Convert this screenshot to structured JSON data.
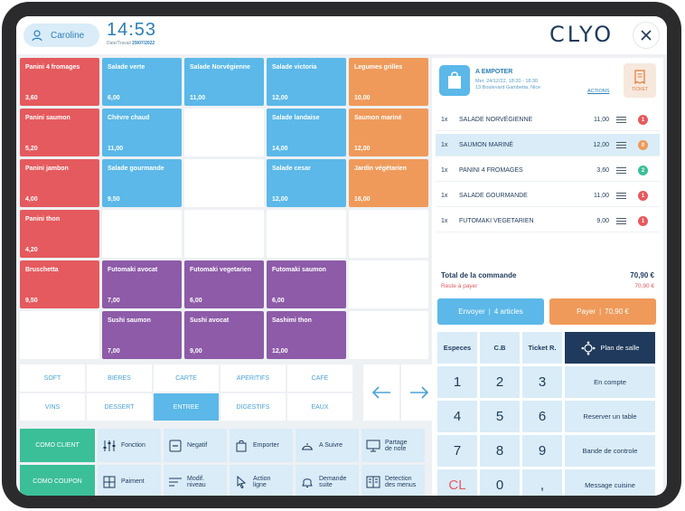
{
  "header": {
    "user_name": "Caroline",
    "clock": "14:53",
    "date_label": "Date/Travail",
    "date_value": "29/07/2022",
    "logo": "CLYO",
    "close_icon": "close-icon"
  },
  "products": [
    {
      "name": "Panini 4 fromages",
      "price": "3,60",
      "color": "red"
    },
    {
      "name": "Salade verte",
      "price": "6,00",
      "color": "blue"
    },
    {
      "name": "Salade Norvégienne",
      "price": "11,00",
      "color": "blue"
    },
    {
      "name": "Salade victoria",
      "price": "12,00",
      "color": "blue"
    },
    {
      "name": "Legumes grilles",
      "price": "10,00",
      "color": "orange"
    },
    {
      "name": "Panini saumon",
      "price": "5,20",
      "color": "red"
    },
    {
      "name": "Chèvre chaud",
      "price": "11,00",
      "color": "blue"
    },
    {
      "name": "",
      "price": "",
      "color": "empty"
    },
    {
      "name": "Salade landaise",
      "price": "14,00",
      "color": "blue"
    },
    {
      "name": "Saumon mariné",
      "price": "12,00",
      "color": "orange"
    },
    {
      "name": "Panini jambon",
      "price": "4,00",
      "color": "red"
    },
    {
      "name": "Salade gourmande",
      "price": "9,50",
      "color": "blue"
    },
    {
      "name": "",
      "price": "",
      "color": "empty"
    },
    {
      "name": "Salade cesar",
      "price": "12,00",
      "color": "blue"
    },
    {
      "name": "Jardin végétarien",
      "price": "16,00",
      "color": "orange"
    },
    {
      "name": "Panini thon",
      "price": "4,20",
      "color": "red"
    },
    {
      "name": "",
      "price": "",
      "color": "empty"
    },
    {
      "name": "",
      "price": "",
      "color": "empty"
    },
    {
      "name": "",
      "price": "",
      "color": "empty"
    },
    {
      "name": "",
      "price": "",
      "color": "empty"
    },
    {
      "name": "Bruschetta",
      "price": "9,50",
      "color": "red"
    },
    {
      "name": "Futomaki avocat",
      "price": "7,00",
      "color": "purple"
    },
    {
      "name": "Futomaki vegetarien",
      "price": "6,00",
      "color": "purple"
    },
    {
      "name": "Futomaki saumon",
      "price": "6,00",
      "color": "purple"
    },
    {
      "name": "",
      "price": "",
      "color": "empty"
    },
    {
      "name": "",
      "price": "",
      "color": "empty"
    },
    {
      "name": "Sushi saumon",
      "price": "7,00",
      "color": "purple"
    },
    {
      "name": "Sushi avocat",
      "price": "9,00",
      "color": "purple"
    },
    {
      "name": "Sashimi thon",
      "price": "12,00",
      "color": "purple"
    },
    {
      "name": "",
      "price": "",
      "color": "empty"
    }
  ],
  "categories": [
    {
      "label": "SOFT",
      "active": false
    },
    {
      "label": "BIERES",
      "active": false
    },
    {
      "label": "CARTE",
      "active": false
    },
    {
      "label": "APERITIFS",
      "active": false
    },
    {
      "label": "CAFE",
      "active": false
    },
    {
      "label": "VINS",
      "active": false
    },
    {
      "label": "DESSERT",
      "active": false
    },
    {
      "label": "ENTREE",
      "active": true
    },
    {
      "label": "DIGESTIFS",
      "active": false
    },
    {
      "label": "EAUX",
      "active": false
    }
  ],
  "functions": {
    "como_client": "COMO CLIENT",
    "como_coupon": "COMO COUPON",
    "row1": [
      {
        "label": "Fonction",
        "icon": "sliders-icon"
      },
      {
        "label": "Negatif",
        "icon": "minus-box-icon"
      },
      {
        "label": "Emporter",
        "icon": "bag-icon"
      },
      {
        "label": "A Suivre",
        "icon": "cloche-icon"
      },
      {
        "label": "Partage de note",
        "icon": "split-icon"
      }
    ],
    "row2": [
      {
        "label": "Paiment",
        "icon": "calculator-icon"
      },
      {
        "label": "Modif. niveau",
        "icon": "levels-icon"
      },
      {
        "label": "Action ligne",
        "icon": "pointer-icon"
      },
      {
        "label": "Demande suite",
        "icon": "bell-icon"
      },
      {
        "label": "Detection des menus",
        "icon": "menu-book-icon"
      }
    ]
  },
  "order": {
    "type": "A EMPOTER",
    "datetime": "Mer. 24/12/22, 18:20 - 18:30",
    "address": "13 Boulevard Gambetta, Nice",
    "actions": "ACTIONS",
    "ticket": "TICKET",
    "lines": [
      {
        "qty": "1x",
        "name": "SALADE NORVÉGIENNE",
        "price": "11,00",
        "badge": "1",
        "badge_color": "#e55a5e",
        "selected": false
      },
      {
        "qty": "1x",
        "name": "SAUMON MARINÉ",
        "price": "12,00",
        "badge": "0",
        "badge_color": "#ef9a5a",
        "selected": true
      },
      {
        "qty": "1x",
        "name": "PANINI 4 FROMAGES",
        "price": "3,60",
        "badge": "2",
        "badge_color": "#3bbf99",
        "selected": false
      },
      {
        "qty": "1x",
        "name": "SALADE GOURMANDE",
        "price": "11,00",
        "badge": "1",
        "badge_color": "#e55a5e",
        "selected": false
      },
      {
        "qty": "1x",
        "name": "FUTOMAKI VEGETARIEN",
        "price": "9,00",
        "badge": "1",
        "badge_color": "#e55a5e",
        "selected": false
      }
    ],
    "total_label": "Total de la commande",
    "total_value": "70,90 €",
    "rest_label": "Reste à payer",
    "rest_value": "70,90 €",
    "send_label": "Envoyer",
    "send_count": "4 articles",
    "pay_label": "Payer",
    "pay_amount": "70,90 €"
  },
  "keypad": {
    "especes": "Especes",
    "cb": "C.B",
    "ticket_r": "Ticket R.",
    "plan": "Plan de salle",
    "k1": "1",
    "k2": "2",
    "k3": "3",
    "k4": "4",
    "k5": "5",
    "k6": "6",
    "k7": "7",
    "k8": "8",
    "k9": "9",
    "cl": "CL",
    "k0": "0",
    "comma": ",",
    "en_compte": "En compte",
    "reserver": "Reserver un table",
    "bande": "Bande de controle",
    "message": "Message cuisine"
  },
  "colors": {
    "red": "#e55a5e",
    "blue": "#5bb8e8",
    "orange": "#ef9a5a",
    "purple": "#8d5ba8",
    "green": "#3bbf99",
    "navy": "#1f3a5c"
  }
}
